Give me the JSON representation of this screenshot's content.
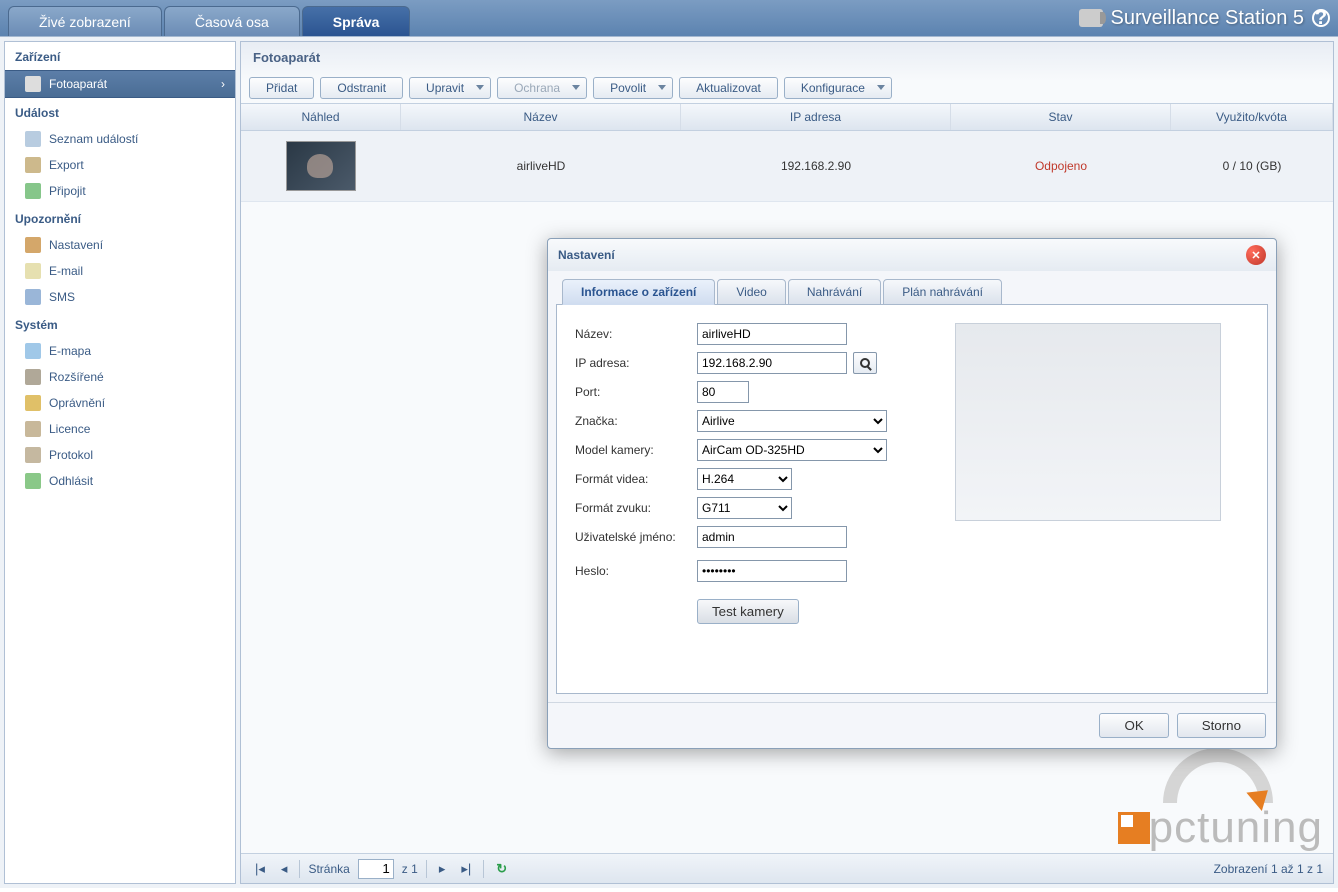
{
  "topTabs": {
    "live": "Živé zobrazení",
    "timeline": "Časová osa",
    "admin": "Správa"
  },
  "brand": "Surveillance Station 5",
  "sidebar": {
    "sec_devices": "Zařízení",
    "camera": "Fotoaparát",
    "sec_event": "Událost",
    "eventList": "Seznam událostí",
    "export": "Export",
    "mount": "Připojit",
    "sec_notif": "Upozornění",
    "settings": "Nastavení",
    "email": "E-mail",
    "sms": "SMS",
    "sec_system": "Systém",
    "emap": "E-mapa",
    "advanced": "Rozšířené",
    "privilege": "Oprávnění",
    "license": "Licence",
    "log": "Protokol",
    "logout": "Odhlásit"
  },
  "panelTitle": "Fotoaparát",
  "toolbar": {
    "add": "Přidat",
    "delete": "Odstranit",
    "edit": "Upravit",
    "guard": "Ochrana",
    "enable": "Povolit",
    "refresh": "Aktualizovat",
    "config": "Konfigurace"
  },
  "gridHead": {
    "preview": "Náhled",
    "name": "Název",
    "ip": "IP adresa",
    "status": "Stav",
    "quota": "Využito/kvóta"
  },
  "row": {
    "name": "airliveHD",
    "ip": "192.168.2.90",
    "status": "Odpojeno",
    "quota": "0 / 10 (GB)"
  },
  "pager": {
    "page": "Stránka",
    "pageNum": "1",
    "of": "z 1",
    "display": "Zobrazení 1 až 1 z 1"
  },
  "dialog": {
    "title": "Nastavení",
    "tabs": {
      "info": "Informace o zařízení",
      "video": "Video",
      "recording": "Nahrávání",
      "schedule": "Plán nahrávání"
    },
    "form": {
      "nameLabel": "Název:",
      "nameVal": "airliveHD",
      "ipLabel": "IP adresa:",
      "ipVal": "192.168.2.90",
      "portLabel": "Port:",
      "portVal": "80",
      "brandLabel": "Značka:",
      "brandVal": "Airlive",
      "modelLabel": "Model kamery:",
      "modelVal": "AirCam OD-325HD",
      "vfmtLabel": "Formát videa:",
      "vfmtVal": "H.264",
      "afmtLabel": "Formát zvuku:",
      "afmtVal": "G711",
      "userLabel": "Uživatelské jméno:",
      "userVal": "admin",
      "passLabel": "Heslo:",
      "passVal": "••••••••",
      "testBtn": "Test kamery"
    },
    "ok": "OK",
    "cancel": "Storno"
  },
  "watermark": "pctuning"
}
